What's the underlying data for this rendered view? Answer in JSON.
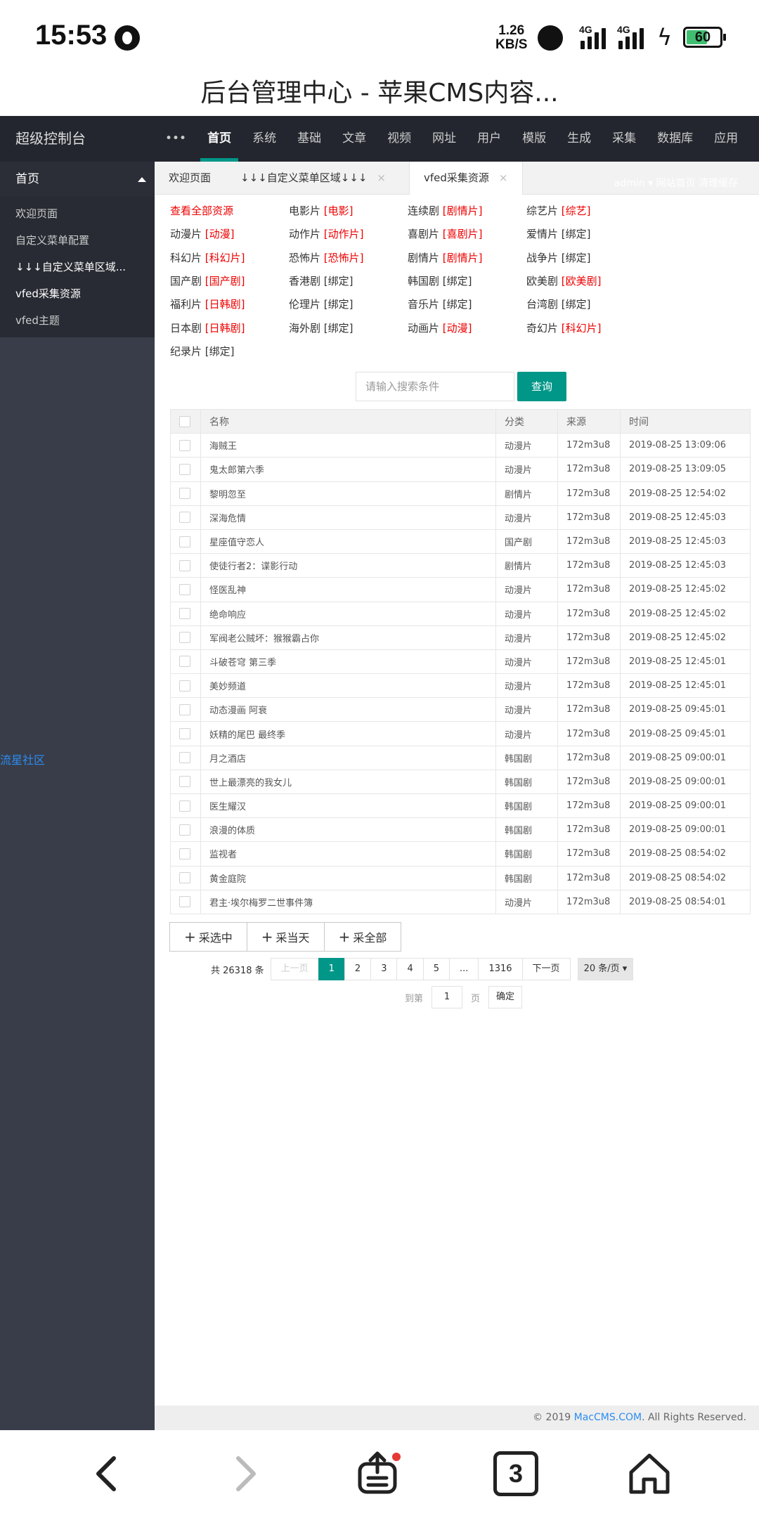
{
  "status_bar": {
    "time": "15:53",
    "speed_value": "1.26",
    "speed_unit": "KB/S",
    "network_1": "4G",
    "network_2": "4G",
    "battery": "60"
  },
  "browser": {
    "title": "后台管理中心 - 苹果CMS内容..."
  },
  "header": {
    "logo": "超级控制台",
    "more": "•••",
    "nav": [
      "首页",
      "系统",
      "基础",
      "文章",
      "视频",
      "网址",
      "用户",
      "模版",
      "生成",
      "采集",
      "数据库",
      "应用"
    ]
  },
  "sidebar": {
    "head": "首页",
    "items": [
      "欢迎页面",
      "自定义菜单配置",
      "↓↓↓自定义菜单区域...",
      "vfed采集资源",
      "vfed主题"
    ],
    "community": "流星社区"
  },
  "tabs": [
    {
      "label": "欢迎页面"
    },
    {
      "label": "↓↓↓自定义菜单区域↓↓↓",
      "close": "×"
    },
    {
      "label": "vfed采集资源",
      "close": "×"
    }
  ],
  "tab_right": "admin ▾  网站首页  清理缓存",
  "categories": [
    {
      "name": "查看全部资源",
      "bind": "",
      "all": true
    },
    {
      "name": "电影片",
      "bind": "[电影]",
      "red": true
    },
    {
      "name": "连续剧",
      "bind": "[剧情片]",
      "red": true
    },
    {
      "name": "综艺片",
      "bind": "[综艺]",
      "red": true
    },
    {
      "name": "动漫片",
      "bind": "[动漫]",
      "red": true
    },
    {
      "name": "动作片",
      "bind": "[动作片]",
      "red": true
    },
    {
      "name": "喜剧片",
      "bind": "[喜剧片]",
      "red": true
    },
    {
      "name": "爱情片",
      "bind": "[绑定]",
      "red": false
    },
    {
      "name": "科幻片",
      "bind": "[科幻片]",
      "red": true
    },
    {
      "name": "恐怖片",
      "bind": "[恐怖片]",
      "red": true
    },
    {
      "name": "剧情片",
      "bind": "[剧情片]",
      "red": true
    },
    {
      "name": "战争片",
      "bind": "[绑定]",
      "red": false
    },
    {
      "name": "国产剧",
      "bind": "[国产剧]",
      "red": true
    },
    {
      "name": "香港剧",
      "bind": "[绑定]",
      "red": false
    },
    {
      "name": "韩国剧",
      "bind": "[绑定]",
      "red": false
    },
    {
      "name": "欧美剧",
      "bind": "[欧美剧]",
      "red": true
    },
    {
      "name": "福利片",
      "bind": "[日韩剧]",
      "red": true
    },
    {
      "name": "伦理片",
      "bind": "[绑定]",
      "red": false
    },
    {
      "name": "音乐片",
      "bind": "[绑定]",
      "red": false
    },
    {
      "name": "台湾剧",
      "bind": "[绑定]",
      "red": false
    },
    {
      "name": "日本剧",
      "bind": "[日韩剧]",
      "red": true
    },
    {
      "name": "海外剧",
      "bind": "[绑定]",
      "red": false
    },
    {
      "name": "动画片",
      "bind": "[动漫]",
      "red": true
    },
    {
      "name": "奇幻片",
      "bind": "[科幻片]",
      "red": true
    },
    {
      "name": "纪录片",
      "bind": "[绑定]",
      "red": false
    }
  ],
  "search": {
    "placeholder": "请输入搜索条件",
    "button": "查询"
  },
  "table": {
    "headers": [
      "",
      "名称",
      "分类",
      "来源",
      "时间"
    ],
    "rows": [
      [
        "海贼王",
        "动漫片",
        "172m3u8",
        "2019-08-25 13:09:06"
      ],
      [
        "鬼太郎第六季",
        "动漫片",
        "172m3u8",
        "2019-08-25 13:09:05"
      ],
      [
        "黎明忽至",
        "剧情片",
        "172m3u8",
        "2019-08-25 12:54:02"
      ],
      [
        "深海危情",
        "动漫片",
        "172m3u8",
        "2019-08-25 12:45:03"
      ],
      [
        "星座值守恋人",
        "国产剧",
        "172m3u8",
        "2019-08-25 12:45:03"
      ],
      [
        "使徒行者2：谍影行动",
        "剧情片",
        "172m3u8",
        "2019-08-25 12:45:03"
      ],
      [
        "怪医乱神",
        "动漫片",
        "172m3u8",
        "2019-08-25 12:45:02"
      ],
      [
        "绝命响应",
        "动漫片",
        "172m3u8",
        "2019-08-25 12:45:02"
      ],
      [
        "军阀老公贼坏：猴猴霸占你",
        "动漫片",
        "172m3u8",
        "2019-08-25 12:45:02"
      ],
      [
        "斗破苍穹 第三季",
        "动漫片",
        "172m3u8",
        "2019-08-25 12:45:01"
      ],
      [
        "美妙频道",
        "动漫片",
        "172m3u8",
        "2019-08-25 12:45:01"
      ],
      [
        "动态漫画 阿衰",
        "动漫片",
        "172m3u8",
        "2019-08-25 09:45:01"
      ],
      [
        "妖精的尾巴 最终季",
        "动漫片",
        "172m3u8",
        "2019-08-25 09:45:01"
      ],
      [
        "月之酒店",
        "韩国剧",
        "172m3u8",
        "2019-08-25 09:00:01"
      ],
      [
        "世上最漂亮的我女儿",
        "韩国剧",
        "172m3u8",
        "2019-08-25 09:00:01"
      ],
      [
        "医生耀汉",
        "韩国剧",
        "172m3u8",
        "2019-08-25 09:00:01"
      ],
      [
        "浪漫的体质",
        "韩国剧",
        "172m3u8",
        "2019-08-25 09:00:01"
      ],
      [
        "监视者",
        "韩国剧",
        "172m3u8",
        "2019-08-25 08:54:02"
      ],
      [
        "黄金庭院",
        "韩国剧",
        "172m3u8",
        "2019-08-25 08:54:02"
      ],
      [
        "君主·埃尔梅罗二世事件簿",
        "动漫片",
        "172m3u8",
        "2019-08-25 08:54:01"
      ]
    ]
  },
  "actions": [
    "采选中",
    "采当天",
    "采全部"
  ],
  "pagination": {
    "total": "共 26318 条",
    "prev": "上一页",
    "pages": [
      "1",
      "2",
      "3",
      "4",
      "5",
      "...",
      "1316"
    ],
    "current": "1",
    "next": "下一页",
    "limit": "20 条/页",
    "goto_label": "到第",
    "goto_value": "1",
    "page_label": "页",
    "confirm": "确定"
  },
  "footer": {
    "prefix": "© 2019 ",
    "link": "MacCMS.COM",
    "suffix": ". All Rights Reserved."
  },
  "bottom_bar": {
    "tab_count": "3",
    "icons": [
      "back-icon",
      "forward-icon",
      "share-icon",
      "tabs-icon",
      "home-icon"
    ]
  },
  "colors": {
    "accent": "#009688",
    "header_bg": "#23262e",
    "sidebar_bg": "#393d49",
    "red": "#ee0000",
    "link": "#2d8cf0"
  }
}
